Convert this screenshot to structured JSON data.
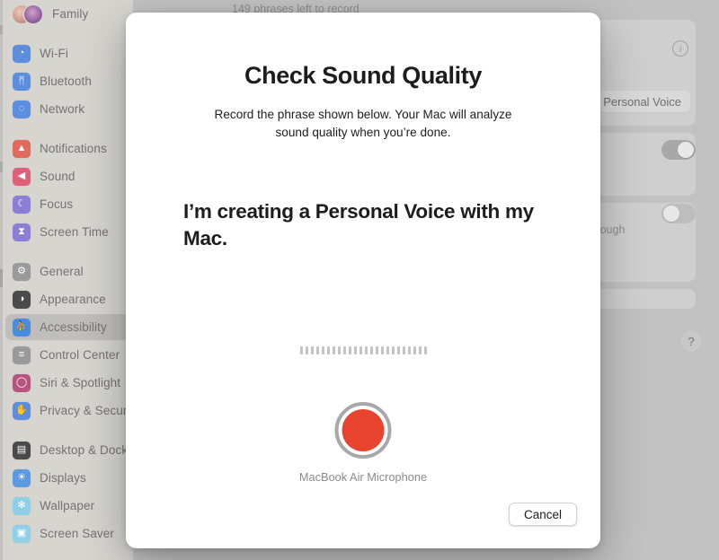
{
  "sidebar": {
    "items": [
      {
        "label": "Family",
        "icon": "family-avatars-icon",
        "type": "avatar",
        "color": ""
      },
      {
        "type": "gap"
      },
      {
        "label": "Wi-Fi",
        "icon": "wifi-icon",
        "glyph": "◔",
        "color": "#5b8ede"
      },
      {
        "label": "Bluetooth",
        "icon": "bluetooth-icon",
        "glyph": "ᛗ",
        "color": "#5b8ede"
      },
      {
        "label": "Network",
        "icon": "network-globe-icon",
        "glyph": "◌",
        "color": "#5b8ede"
      },
      {
        "type": "gap"
      },
      {
        "label": "Notifications",
        "icon": "notifications-bell-icon",
        "glyph": "▲",
        "color": "#e06a5c"
      },
      {
        "label": "Sound",
        "icon": "sound-speaker-icon",
        "glyph": "◀",
        "color": "#e0607a"
      },
      {
        "label": "Focus",
        "icon": "focus-moon-icon",
        "glyph": "☾",
        "color": "#8b7ed8"
      },
      {
        "label": "Screen Time",
        "icon": "screen-time-hourglass-icon",
        "glyph": "⧗",
        "color": "#8b7ed8"
      },
      {
        "type": "gap"
      },
      {
        "label": "General",
        "icon": "general-gear-icon",
        "glyph": "⚙",
        "color": "#9a9a9a"
      },
      {
        "label": "Appearance",
        "icon": "appearance-contrast-icon",
        "glyph": "◑",
        "color": "#4a4a4a"
      },
      {
        "label": "Accessibility",
        "icon": "accessibility-person-icon",
        "glyph": "⛹",
        "color": "#4a8ce0",
        "selected": true
      },
      {
        "label": "Control Center",
        "icon": "control-center-icon",
        "glyph": "≡",
        "color": "#9a9a9a"
      },
      {
        "label": "Siri & Spotlight",
        "icon": "siri-spotlight-icon",
        "glyph": "◯",
        "color": "#b8557f"
      },
      {
        "label": "Privacy & Security",
        "icon": "privacy-hand-icon",
        "glyph": "✋",
        "color": "#5b8ede"
      },
      {
        "type": "gap"
      },
      {
        "label": "Desktop & Dock",
        "icon": "desktop-dock-icon",
        "glyph": "▤",
        "color": "#4a4a4a"
      },
      {
        "label": "Displays",
        "icon": "displays-brightness-icon",
        "glyph": "☀",
        "color": "#5b9ae0"
      },
      {
        "label": "Wallpaper",
        "icon": "wallpaper-icon",
        "glyph": "✻",
        "color": "#8fcfe8"
      },
      {
        "label": "Screen Saver",
        "icon": "screen-saver-icon",
        "glyph": "▣",
        "color": "#8fcfe8"
      }
    ]
  },
  "background": {
    "phrases_left": "149 phrases left to record",
    "info_icon": "info-icon",
    "info_glyph": "i",
    "personal_voice_label": "Personal Voice",
    "toggle_on_state": "on",
    "toggle_off_state": "off",
    "partial_text": "through",
    "help_label": "?",
    "help_icon": "help-question-icon"
  },
  "dialog": {
    "name": "check-sound-quality-sheet",
    "title": "Check Sound Quality",
    "subtitle": "Record the phrase shown below. Your Mac will analyze sound quality when you’re done.",
    "phrase": "I’m creating a Personal Voice with my Mac.",
    "level_meter": {
      "icon": "audio-level-meter",
      "bar_count": 24,
      "bar_color": "#c3c3c3"
    },
    "record_button": {
      "icon": "record-button-icon",
      "fill_color": "#e8432f",
      "ring_color": "#a8a8a8",
      "state": "ready"
    },
    "microphone_label": "MacBook Air Microphone",
    "cancel_label": "Cancel"
  },
  "colors": {
    "sheet_bg": "#ffffff",
    "sidebar_bg": "#d6d5d0",
    "backdrop": "#b9b9b9",
    "record_red": "#e8432f",
    "text_primary": "#1d1d1f",
    "text_secondary": "#8c8c8c"
  }
}
